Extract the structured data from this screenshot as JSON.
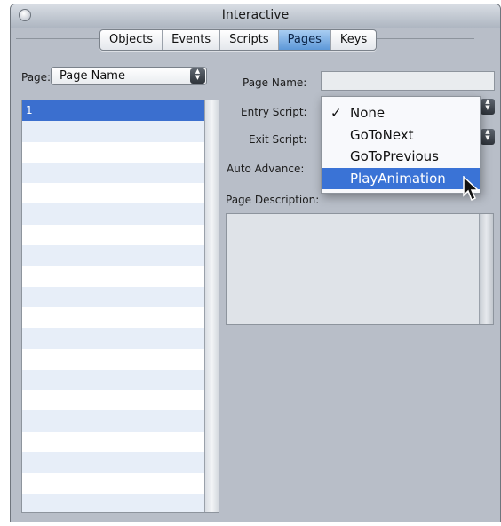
{
  "window": {
    "title": "Interactive"
  },
  "tabs": [
    {
      "label": "Objects",
      "active": false
    },
    {
      "label": "Events",
      "active": false
    },
    {
      "label": "Scripts",
      "active": false
    },
    {
      "label": "Pages",
      "active": true
    },
    {
      "label": "Keys",
      "active": false
    }
  ],
  "left": {
    "page_label": "Page:",
    "page_select_value": "Page Name",
    "list_items": [
      "1"
    ]
  },
  "fields": {
    "page_name_label": "Page Name:",
    "page_name_value": "",
    "entry_script_label": "Entry Script:",
    "exit_script_label": "Exit Script:",
    "auto_advance_label": "Auto Advance:",
    "page_description_label": "Page Description:"
  },
  "menu": {
    "items": [
      "None",
      "GoToNext",
      "GoToPrevious",
      "PlayAnimation"
    ],
    "checked_item": "None",
    "highlighted_item": "PlayAnimation",
    "check_mark": "✓"
  },
  "colors": {
    "window_bg": "#b8bec8",
    "accent_blue": "#3a73d6",
    "active_tab": "#5d98d8"
  }
}
